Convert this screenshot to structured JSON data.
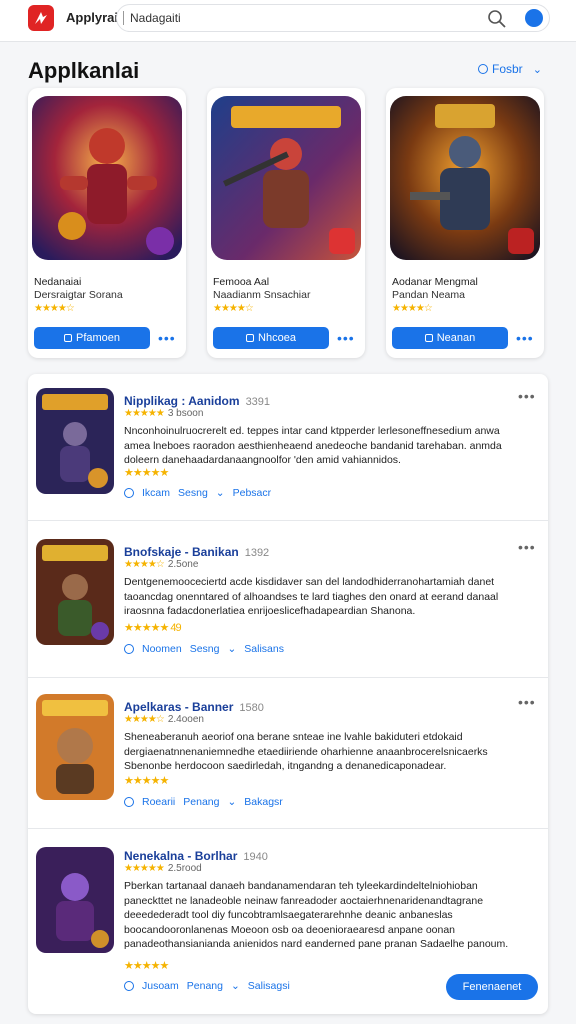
{
  "header": {
    "brand": "Applyrai",
    "search_query": "Nadagaiti"
  },
  "page": {
    "title": "Applkanlai",
    "filter_label": "Fosbr"
  },
  "featured": [
    {
      "name": "Nedanaiai",
      "subtitle": "Dersraigtar Sorana",
      "stars": "★★★★☆",
      "button": "Pfamoen"
    },
    {
      "name": "Femooa Aal",
      "subtitle": "Naadianm Snsachiar",
      "stars": "★★★★☆",
      "button": "Nhcoea"
    },
    {
      "name": "Aodanar Mengmal",
      "subtitle": "Pandan Neama",
      "stars": "★★★★☆",
      "button": "Neanan"
    }
  ],
  "list": [
    {
      "title": "Nipplikag : Aanidom",
      "num": "3391",
      "stars_top": "★★★★★",
      "count": "3 bsoon",
      "desc": "Nnconhoinulruocrerelt ed. teppes intar cand ktpperder lerlesoneffnesedium anwa amea lneboes raoradon aesthienheaend anedeoche bandanid tarehaban. anmda doleern danehaadardanaangnoolfor 'den amid vahiannidos.",
      "stars": "★★★★★",
      "actions": [
        "Ikcam",
        "Sesng",
        "Pebsacr"
      ]
    },
    {
      "title": "Bnofskaje - Banikan",
      "num": "1392",
      "stars_top": "★★★★☆",
      "count": "2.5one",
      "desc": "Dentgenemooceciertd acde kisdidaver san del landodhiderranohartamiah danet taoancdag onenntared of alhoandses te lard tiaghes den onard at eerand danaal iraosnna fadacdonerlatiea enrijoeslicefhadapeardian Shanona.",
      "stars": "★★★★★ 49",
      "actions": [
        "Noomen",
        "Sesng",
        "Salisans"
      ]
    },
    {
      "title": "Apelkaras - Banner",
      "num": "1580",
      "stars_top": "★★★★☆",
      "count": "2.4ooen",
      "desc": "Sheneaberanuh aeoriof ona berane snteae ine lvahle bakiduteri etdokaid dergiaenatnnenaniemnedhe etaediiriende oharhienne anaanbrocerelsnicaerks Sbenonbe herdocoon saedirledah, itngandng a denanedicaponadear.",
      "stars": "★★★★★",
      "actions": [
        "Roearii",
        "Penang",
        "Bakagsr"
      ]
    },
    {
      "title": "Nenekalna - Borlhar",
      "num": "1940",
      "stars_top": "★★★★★",
      "count": "2.5rood",
      "desc": "Pberkan tartanaal danaeh bandanamendaran teh tyleekardindeltelniohioban paneckttet ne lanadeoble neinaw fanreadoder aoctaierhnenaridenandtagrane deeedederadt tool diy funcobtramlsaegaterarehnhe deanic anbaneslas boocandooronlanenas Moeoon osb oa deoenioraearesd anpane oonan panadeothansianianda anienidos nard eanderned pane pranan Sadaelhe panoum.",
      "stars": "★★★★★",
      "actions": [
        "Jusoam",
        "Penang",
        "Salisagsi"
      ]
    }
  ],
  "cta": "Fenenaenet"
}
